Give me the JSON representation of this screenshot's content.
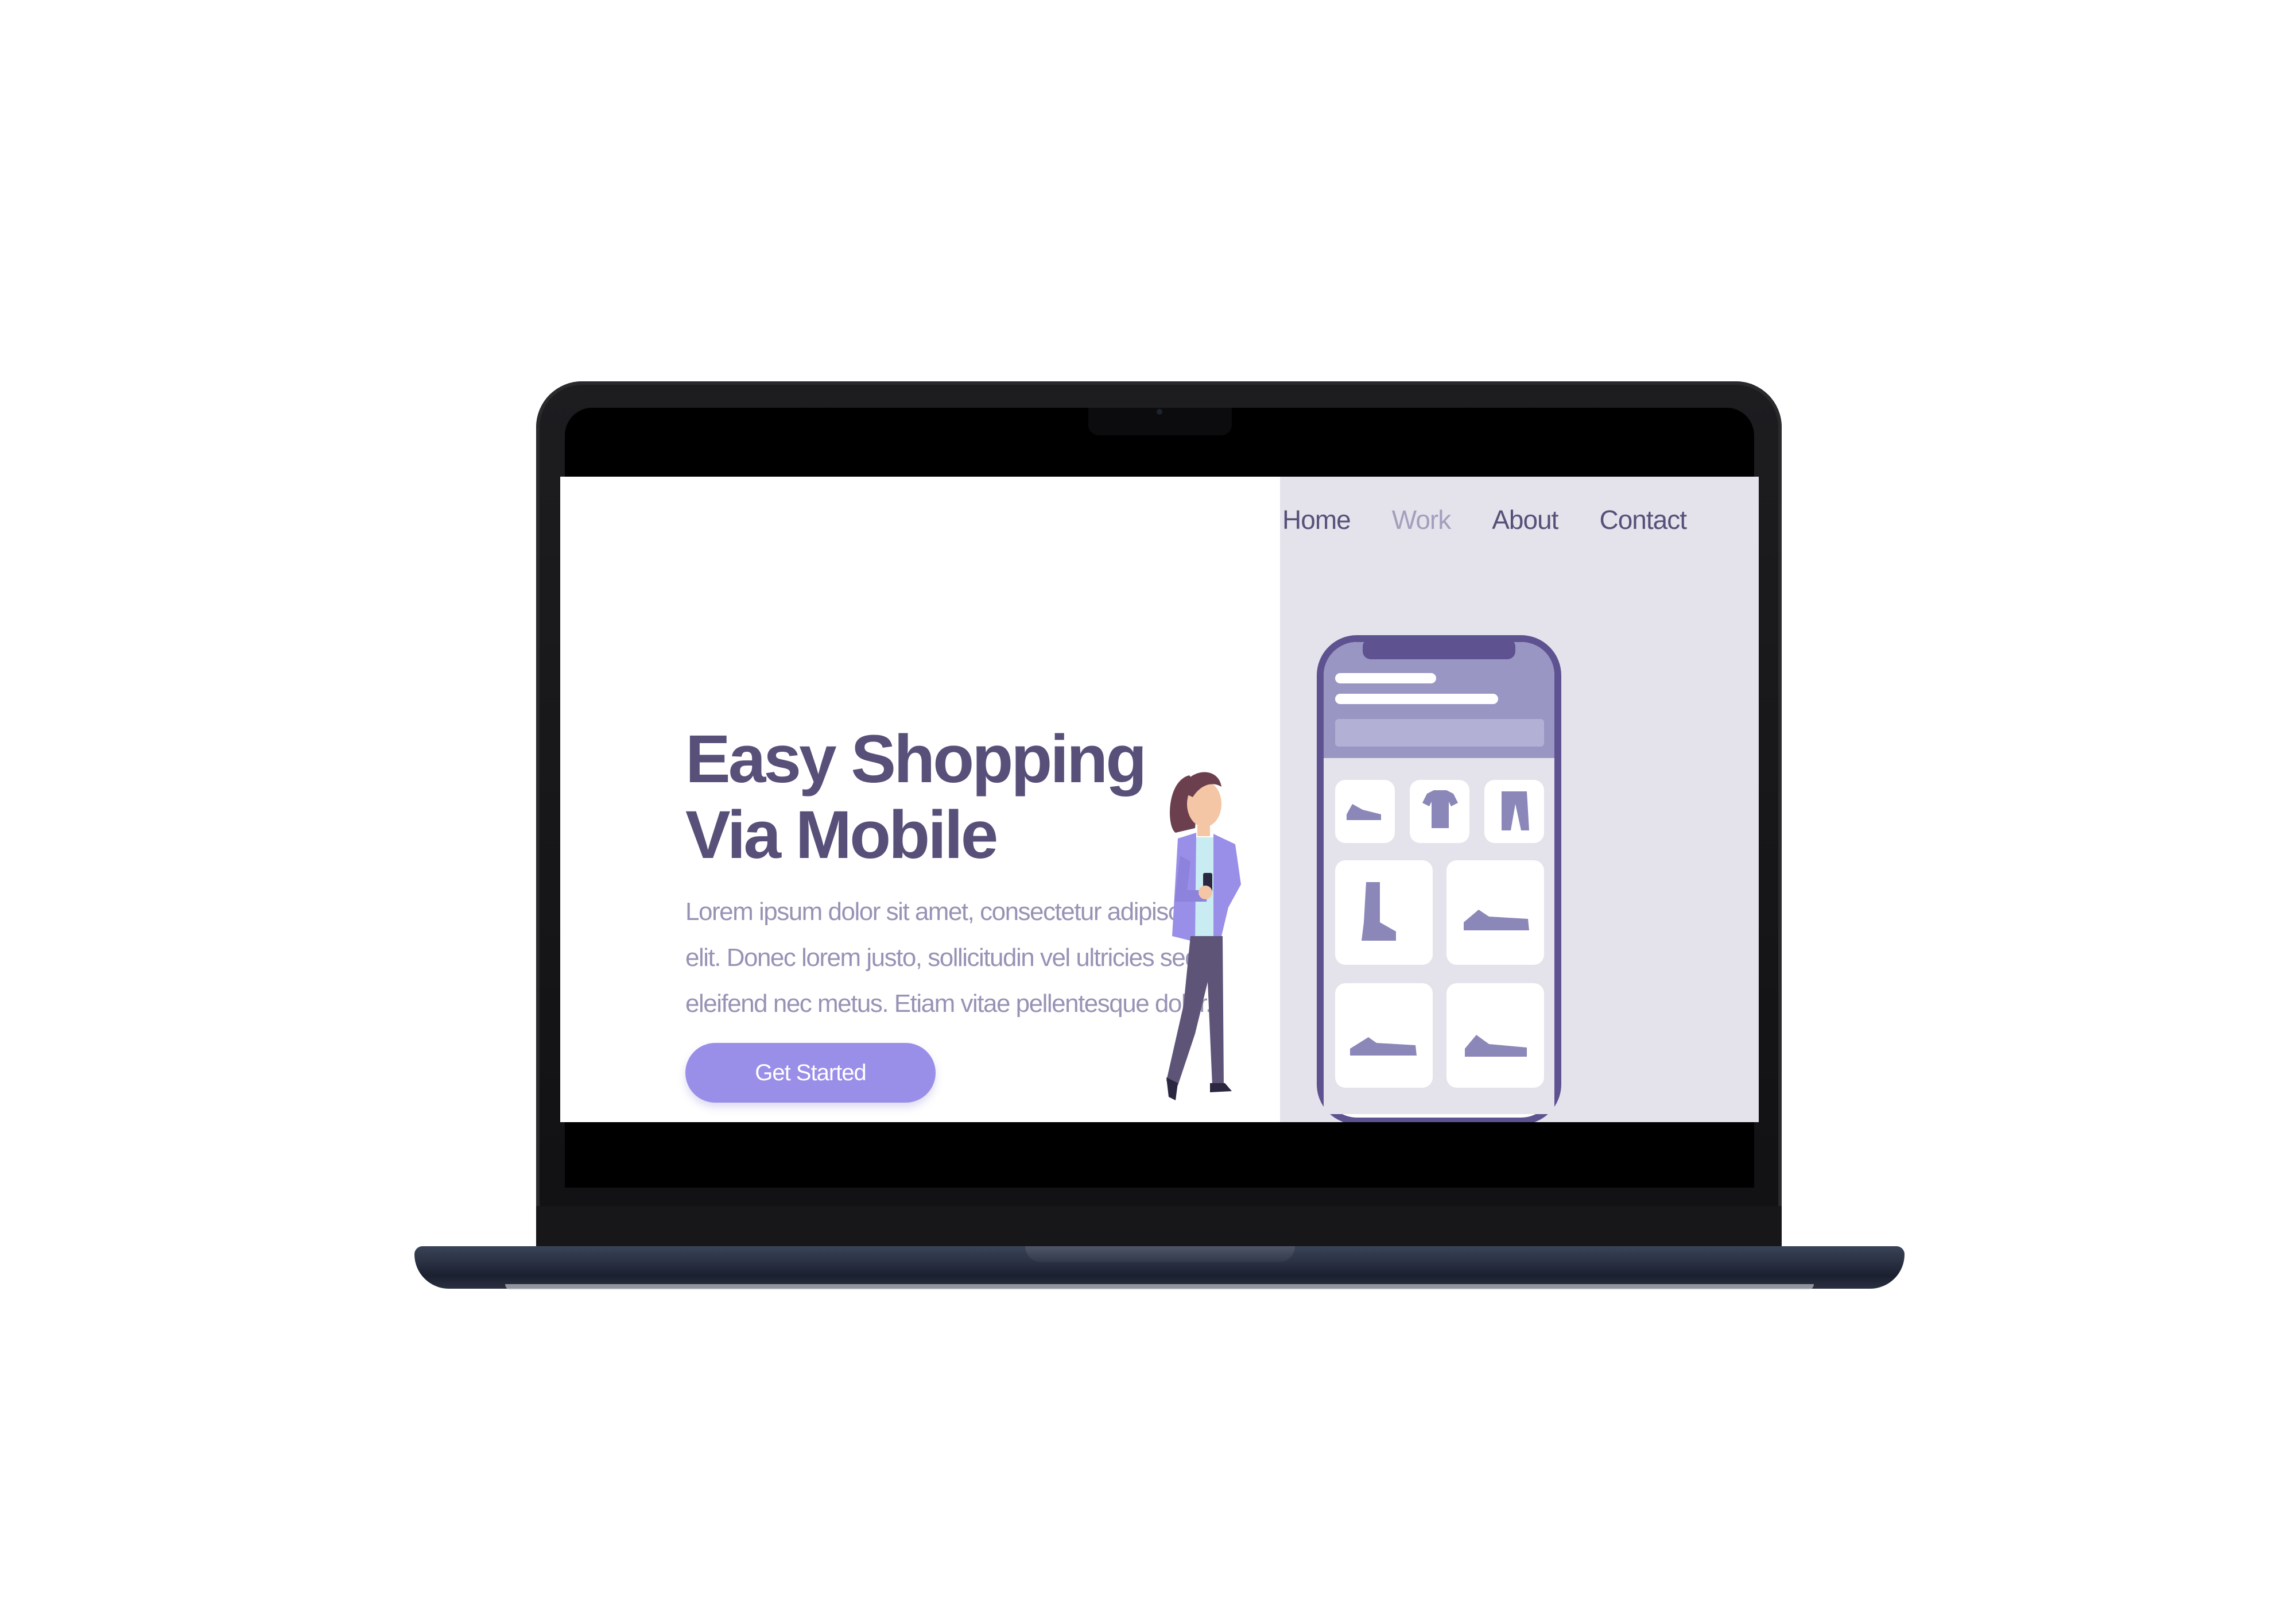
{
  "nav": {
    "items": [
      {
        "label": "Home",
        "muted": false
      },
      {
        "label": "Work",
        "muted": true
      },
      {
        "label": "About",
        "muted": false
      },
      {
        "label": "Contact",
        "muted": false
      }
    ]
  },
  "hero": {
    "title_line1": "Easy Shopping",
    "title_line2": "Via Mobile",
    "text_line1": "Lorem ipsum dolor sit amet, consectetur adipiscing",
    "text_line2": "elit. Donec lorem justo, sollicitudin vel ultricies sed,",
    "text_line3": "eleifend nec metus. Etiam vitae pellentesque dolor.",
    "cta_label": "Get Started"
  },
  "phone_grid_icons": [
    "sneaker-icon",
    "tshirt-icon",
    "pants-icon",
    "boot-icon",
    "sneaker-icon",
    "sneaker-icon",
    "sneaker-icon"
  ],
  "colors": {
    "accent": "#9a8fe8",
    "heading": "#585079",
    "muted": "#9893b5",
    "panel": "#e4e3ec",
    "phone_frame": "#5e5291",
    "phone_header": "#9996c4"
  }
}
